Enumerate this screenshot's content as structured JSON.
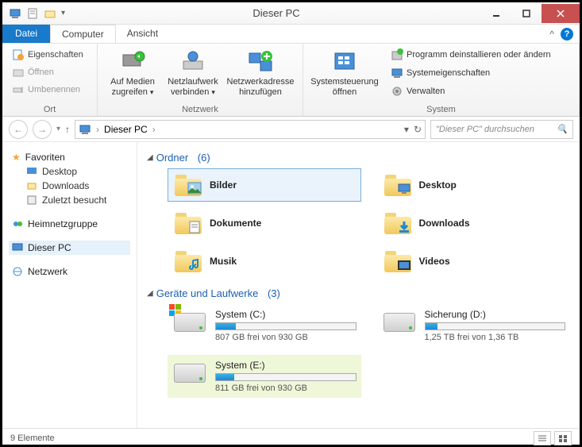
{
  "title": "Dieser PC",
  "tabs": {
    "datei": "Datei",
    "computer": "Computer",
    "ansicht": "Ansicht"
  },
  "ribbon": {
    "ort": {
      "label": "Ort",
      "eigenschaften": "Eigenschaften",
      "oeffnen": "Öffnen",
      "umbenennen": "Umbenennen"
    },
    "netzwerk": {
      "label": "Netzwerk",
      "medien": "Auf Medien zugreifen",
      "netzlaufwerk": "Netzlaufwerk verbinden",
      "adresse": "Netzwerkadresse hinzufügen"
    },
    "system": {
      "label": "System",
      "steuerung": "Systemsteuerung öffnen",
      "deinstall": "Programm deinstallieren oder ändern",
      "eigenschaften": "Systemeigenschaften",
      "verwalten": "Verwalten"
    }
  },
  "address": {
    "root": "Dieser PC"
  },
  "search": {
    "placeholder": "\"Dieser PC\" durchsuchen"
  },
  "sidebar": {
    "favoriten": "Favoriten",
    "desktop": "Desktop",
    "downloads": "Downloads",
    "zuletzt": "Zuletzt besucht",
    "heimnetz": "Heimnetzgruppe",
    "dieserpc": "Dieser PC",
    "netzwerk": "Netzwerk"
  },
  "sections": {
    "ordner": {
      "label": "Ordner",
      "count": "(6)"
    },
    "geraete": {
      "label": "Geräte und Laufwerke",
      "count": "(3)"
    }
  },
  "folders": [
    {
      "label": "Bilder"
    },
    {
      "label": "Desktop"
    },
    {
      "label": "Dokumente"
    },
    {
      "label": "Downloads"
    },
    {
      "label": "Musik"
    },
    {
      "label": "Videos"
    }
  ],
  "drives": [
    {
      "name": "System (C:)",
      "free": "807 GB frei von 930 GB",
      "fill_pct": 14,
      "has_win_logo": true
    },
    {
      "name": "Sicherung (D:)",
      "free": "1,25 TB frei von 1,36 TB",
      "fill_pct": 9
    },
    {
      "name": "System (E:)",
      "free": "811 GB frei von 930 GB",
      "fill_pct": 13,
      "highlight": true
    }
  ],
  "status": {
    "count": "9 Elemente"
  }
}
